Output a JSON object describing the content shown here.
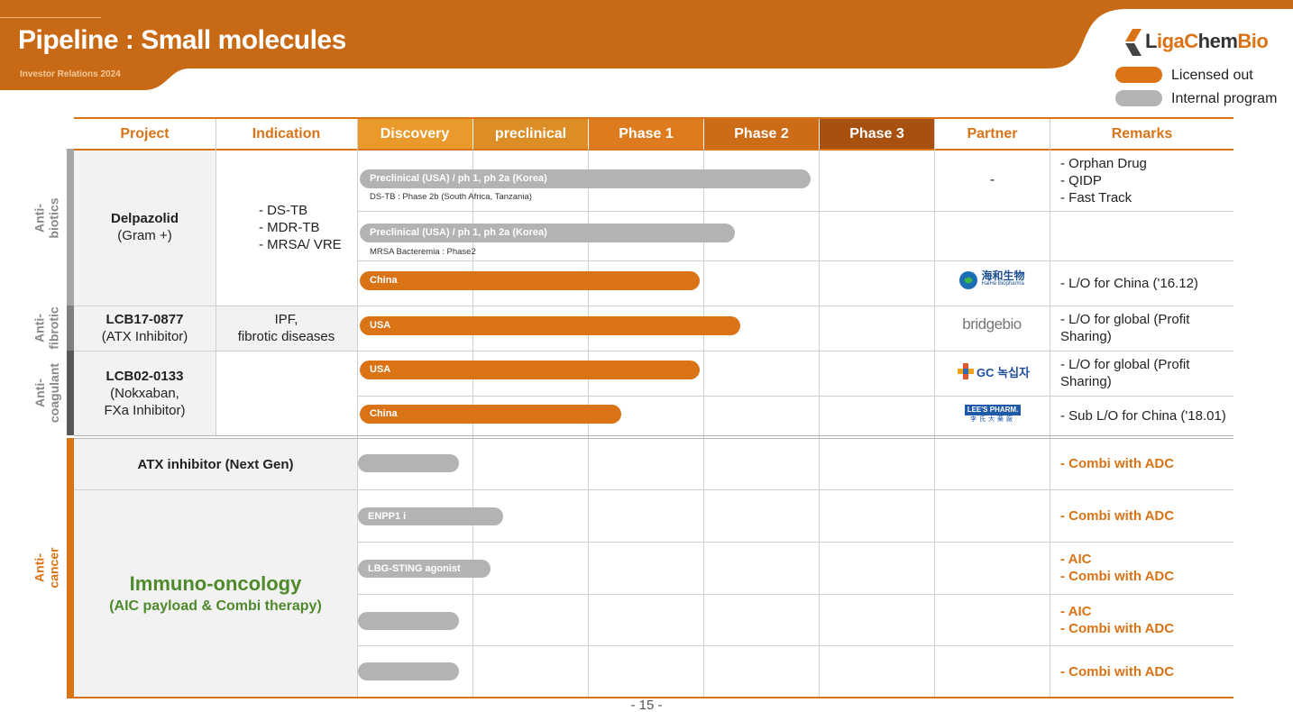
{
  "header": {
    "title": "Pipeline : Small molecules",
    "subtitle": "Investor Relations 2024",
    "logo_text_1": "L",
    "logo_text_2": "iga",
    "logo_text_3": "C",
    "logo_text_4": "hem",
    "logo_text_5": "Bio"
  },
  "legend": [
    {
      "label": "Licensed out",
      "color": "#d97316"
    },
    {
      "label": "Internal program",
      "color": "#b3b3b3"
    }
  ],
  "columns": [
    "Project",
    "Indication",
    "Discovery",
    "preclinical",
    "Phase 1",
    "Phase 2",
    "Phase 3",
    "Partner",
    "Remarks"
  ],
  "categories": {
    "antibiotics": "Anti-\nbiotics",
    "antifibrotic": "Anti-\nfibrotic",
    "anticoagulant": "Anti-\ncoagulant",
    "anticancer": "Anti-\ncancer"
  },
  "rows": {
    "delpazolid": {
      "project_1": "Delpazolid",
      "project_2": "(Gram +)",
      "indications": [
        "- DS-TB",
        "- MDR-TB",
        "- MRSA/ VRE"
      ],
      "bar1": "Preclinical (USA) / ph 1, ph 2a (Korea)",
      "note1": "DS-TB : Phase 2b (South Africa, Tanzania)",
      "bar2": "Preclinical (USA) / ph 1, ph 2a (Korea)",
      "note2": "MRSA Bacteremia : Phase2",
      "bar3": "China",
      "partner1": "-",
      "remarks1": [
        "- Orphan Drug",
        "- QIDP",
        "- Fast Track"
      ],
      "partner3": "HaiHe Biopharma",
      "remarks3": "- L/O for China ('16.12)"
    },
    "lcb17": {
      "project_1": "LCB17-0877",
      "project_2": "(ATX Inhibitor)",
      "indication_1": "IPF,",
      "indication_2": "fibrotic diseases",
      "bar": "USA",
      "partner": "bridgebio",
      "remarks": "- L/O for global (Profit Sharing)"
    },
    "lcb02": {
      "project_1": "LCB02-0133",
      "project_2": "(Nokxaban,",
      "project_3": "FXa Inhibitor)",
      "bar1": "USA",
      "bar2": "China",
      "partner1": "GC 녹십자",
      "partner2": "LEE'S PHARM.",
      "remarks1": "- L/O for global (Profit Sharing)",
      "remarks2": "- Sub L/O for China ('18.01)"
    },
    "atx_next": {
      "project": "ATX inhibitor (Next Gen)",
      "remarks": "- Combi with ADC"
    },
    "io": {
      "title": "Immuno-oncology",
      "sub": "(AIC payload & Combi therapy)",
      "bar1": "ENPP1 i",
      "bar2": "LBG-STING agonist",
      "remarks1": "- Combi with ADC",
      "remarks2_1": "- AIC",
      "remarks2_2": "- Combi with ADC",
      "remarks3_1": "- AIC",
      "remarks3_2": "- Combi with ADC",
      "remarks4": "- Combi with ADC"
    }
  },
  "colors": {
    "accent": "#d97316",
    "header_bg": "#c86a15",
    "discovery": "#e99a2b",
    "preclinical": "#dd8d25",
    "phase1": "#de7b1e",
    "phase2": "#cd6c17",
    "phase3": "#a8500f",
    "io_green": "#4e8a2c"
  },
  "page_number": "- 15 -"
}
